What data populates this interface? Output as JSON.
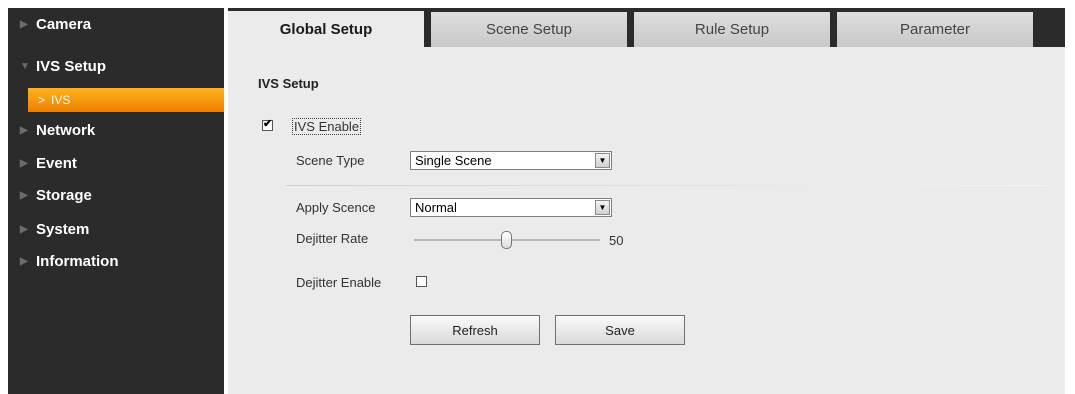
{
  "sidebar": {
    "items": [
      {
        "label": "Camera",
        "arrow": "▶"
      },
      {
        "label": "IVS Setup",
        "arrow": "▼"
      },
      {
        "label": "Network",
        "arrow": "▶"
      },
      {
        "label": "Event",
        "arrow": "▶"
      },
      {
        "label": "Storage",
        "arrow": "▶"
      },
      {
        "label": "System",
        "arrow": "▶"
      },
      {
        "label": "Information",
        "arrow": "▶"
      }
    ],
    "sub_item": {
      "label": "IVS",
      "arrow": ">"
    }
  },
  "tabs": [
    {
      "label": "Global Setup",
      "active": true
    },
    {
      "label": "Scene Setup"
    },
    {
      "label": "Rule Setup"
    },
    {
      "label": "Parameter"
    }
  ],
  "section_title": "IVS Setup",
  "ivs_enable": {
    "label": "IVS Enable",
    "checked": true,
    "check_glyph": "✔"
  },
  "scene_type": {
    "label": "Scene Type",
    "value": "Single Scene",
    "arrow": "▼"
  },
  "apply_scene": {
    "label": "Apply Scence",
    "value": "Normal",
    "arrow": "▼"
  },
  "dejitter_rate": {
    "label": "Dejitter Rate",
    "value": "50"
  },
  "dejitter_enable": {
    "label": "Dejitter Enable",
    "checked": false
  },
  "buttons": {
    "refresh": "Refresh",
    "save": "Save"
  },
  "colors": {
    "sidebar_bg": "#2b2b2b",
    "accent": "#f39200",
    "panel_bg": "#ebebeb"
  }
}
